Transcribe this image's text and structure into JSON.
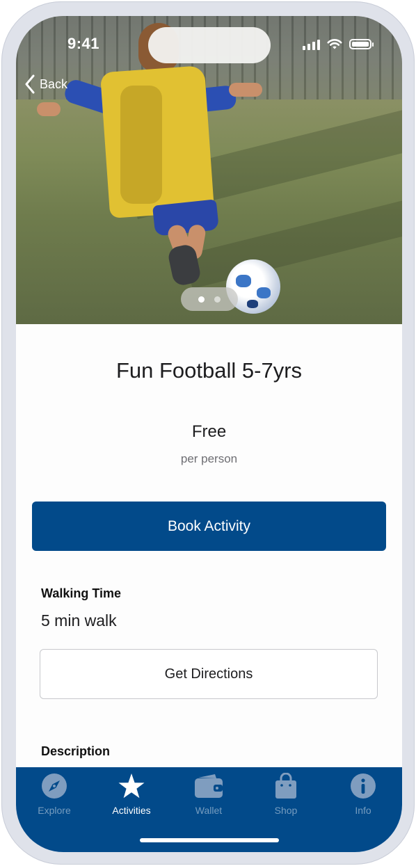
{
  "status_bar": {
    "time": "9:41"
  },
  "nav": {
    "back_label": "Back"
  },
  "hero": {
    "pager": {
      "count": 2,
      "active_index": 0
    }
  },
  "activity": {
    "title": "Fun Football 5-7yrs",
    "price": "Free",
    "price_unit": "per person",
    "book_label": "Book Activity"
  },
  "walking": {
    "heading": "Walking Time",
    "value": "5 min walk",
    "directions_label": "Get Directions"
  },
  "description": {
    "heading": "Description"
  },
  "tabs": [
    {
      "label": "Explore",
      "icon": "compass-icon",
      "active": false
    },
    {
      "label": "Activities",
      "icon": "star-icon",
      "active": true
    },
    {
      "label": "Wallet",
      "icon": "wallet-icon",
      "active": false
    },
    {
      "label": "Shop",
      "icon": "shopping-bag-icon",
      "active": false
    },
    {
      "label": "Info",
      "icon": "info-icon",
      "active": false
    }
  ],
  "colors": {
    "brand_blue": "#024a8a",
    "tab_inactive": "#7f9dbf",
    "tab_active": "#ffffff"
  }
}
